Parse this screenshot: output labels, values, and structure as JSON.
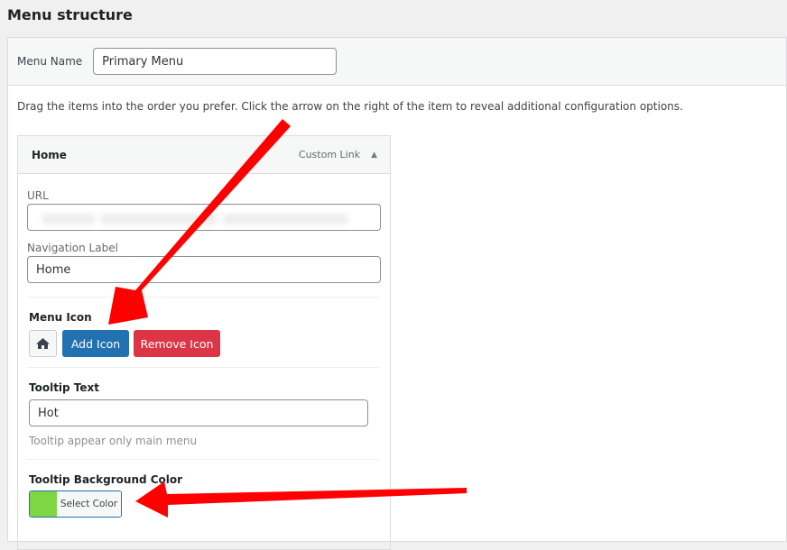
{
  "page": {
    "title": "Menu structure"
  },
  "menu": {
    "name_label": "Menu Name",
    "name_value": "Primary Menu",
    "instructions": "Drag the items into the order you prefer. Click the arrow on the right of the item to reveal additional configuration options."
  },
  "item": {
    "title": "Home",
    "type": "Custom Link",
    "url_label": "URL",
    "nav_label": "Navigation Label",
    "nav_value": "Home",
    "icon_label": "Menu Icon",
    "icon": "home-icon",
    "add_icon": "Add Icon",
    "remove_icon": "Remove Icon",
    "tooltip_label": "Tooltip Text",
    "tooltip_value": "Hot",
    "tooltip_help": "Tooltip appear only main menu",
    "tooltip_bg_label": "Tooltip Background Color",
    "select_color": "Select Color",
    "swatch_color": "#7ed742"
  },
  "colors": {
    "add": "#2271b1",
    "remove": "#dc3545",
    "arrow": "#ff0000"
  }
}
